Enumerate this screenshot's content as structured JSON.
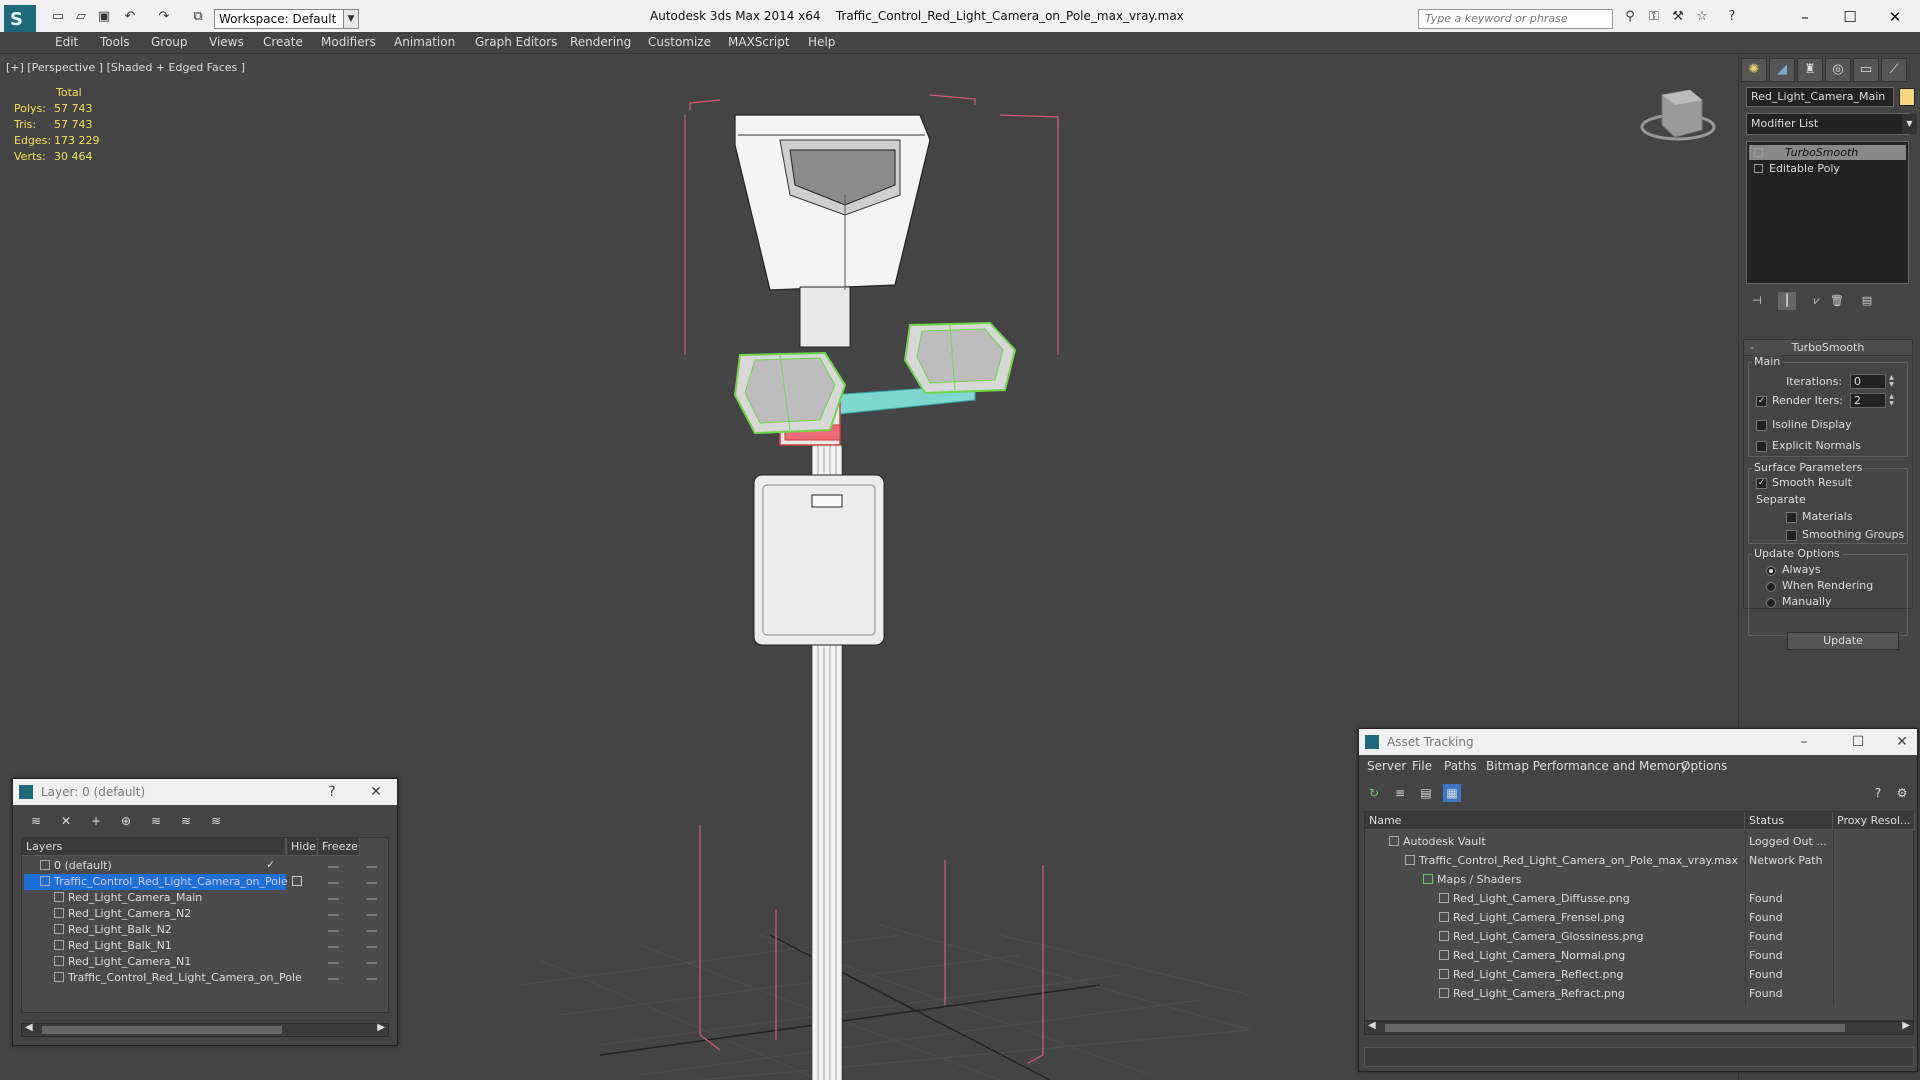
{
  "app": {
    "title": "Autodesk 3ds Max  2014 x64",
    "file": "Traffic_Control_Red_Light_Camera_on_Pole_max_vray.max",
    "workspace": "Workspace: Default",
    "search_placeholder": "Type a keyword or phrase"
  },
  "menu": [
    "Edit",
    "Tools",
    "Group",
    "Views",
    "Create",
    "Modifiers",
    "Animation",
    "Graph Editors",
    "Rendering",
    "Customize",
    "MAXScript",
    "Help"
  ],
  "viewport": {
    "label": "[+] [Perspective ] [Shaded + Edged Faces ]",
    "stats": {
      "header": "Total",
      "rows": [
        {
          "k": "Polys:",
          "v": "57 743"
        },
        {
          "k": "Tris:",
          "v": "57 743"
        },
        {
          "k": "Edges:",
          "v": "173 229"
        },
        {
          "k": "Verts:",
          "v": "30 464"
        }
      ]
    }
  },
  "command_panel": {
    "object_name": "Red_Light_Camera_Main",
    "modifier_list": "Modifier List",
    "stack": [
      "TurboSmooth",
      "Editable Poly"
    ],
    "turbosmooth": {
      "title": "TurboSmooth",
      "main": "Main",
      "iterations_label": "Iterations:",
      "iterations": "0",
      "render_iters_label": "Render Iters:",
      "render_iters": "2",
      "isoline": "Isoline Display",
      "explicit": "Explicit Normals",
      "surface": "Surface Parameters",
      "smooth_result": "Smooth Result",
      "separate": "Separate",
      "materials": "Materials",
      "smoothing_groups": "Smoothing Groups",
      "update_options": "Update Options",
      "always": "Always",
      "when_rendering": "When Rendering",
      "manually": "Manually",
      "update": "Update"
    }
  },
  "layer_dialog": {
    "title": "Layer: 0 (default)",
    "help": "?",
    "col_layers": "Layers",
    "col_hide": "Hide",
    "col_freeze": "Freeze",
    "rows": [
      "0 (default)",
      "Traffic_Control_Red_Light_Camera_on_Pole",
      "Red_Light_Camera_Main",
      "Red_Light_Camera_N2",
      "Red_Light_Balk_N2",
      "Red_Light_Balk_N1",
      "Red_Light_Camera_N1",
      "Traffic_Control_Red_Light_Camera_on_Pole"
    ]
  },
  "asset_dialog": {
    "title": "Asset Tracking",
    "menu": [
      "Server",
      "File",
      "Paths",
      "Bitmap Performance and Memory",
      "Options"
    ],
    "col_name": "Name",
    "col_status": "Status",
    "col_proxy": "Proxy Resol...",
    "rows": [
      {
        "name": "Autodesk Vault",
        "status": "Logged Out ..."
      },
      {
        "name": "Traffic_Control_Red_Light_Camera_on_Pole_max_vray.max",
        "status": "Network Path"
      },
      {
        "name": "Maps / Shaders",
        "status": ""
      },
      {
        "name": "Red_Light_Camera_Diffusse.png",
        "status": "Found"
      },
      {
        "name": "Red_Light_Camera_Frensel.png",
        "status": "Found"
      },
      {
        "name": "Red_Light_Camera_Glossiness.png",
        "status": "Found"
      },
      {
        "name": "Red_Light_Camera_Normal.png",
        "status": "Found"
      },
      {
        "name": "Red_Light_Camera_Reflect.png",
        "status": "Found"
      },
      {
        "name": "Red_Light_Camera_Refract.png",
        "status": "Found"
      }
    ]
  },
  "colors": {
    "selection": "#1e6ed8",
    "stats": "#f0e05a",
    "object_color": "#f5d77f",
    "bbox": "#d65a78",
    "selected_wire": "#7ee06a"
  }
}
